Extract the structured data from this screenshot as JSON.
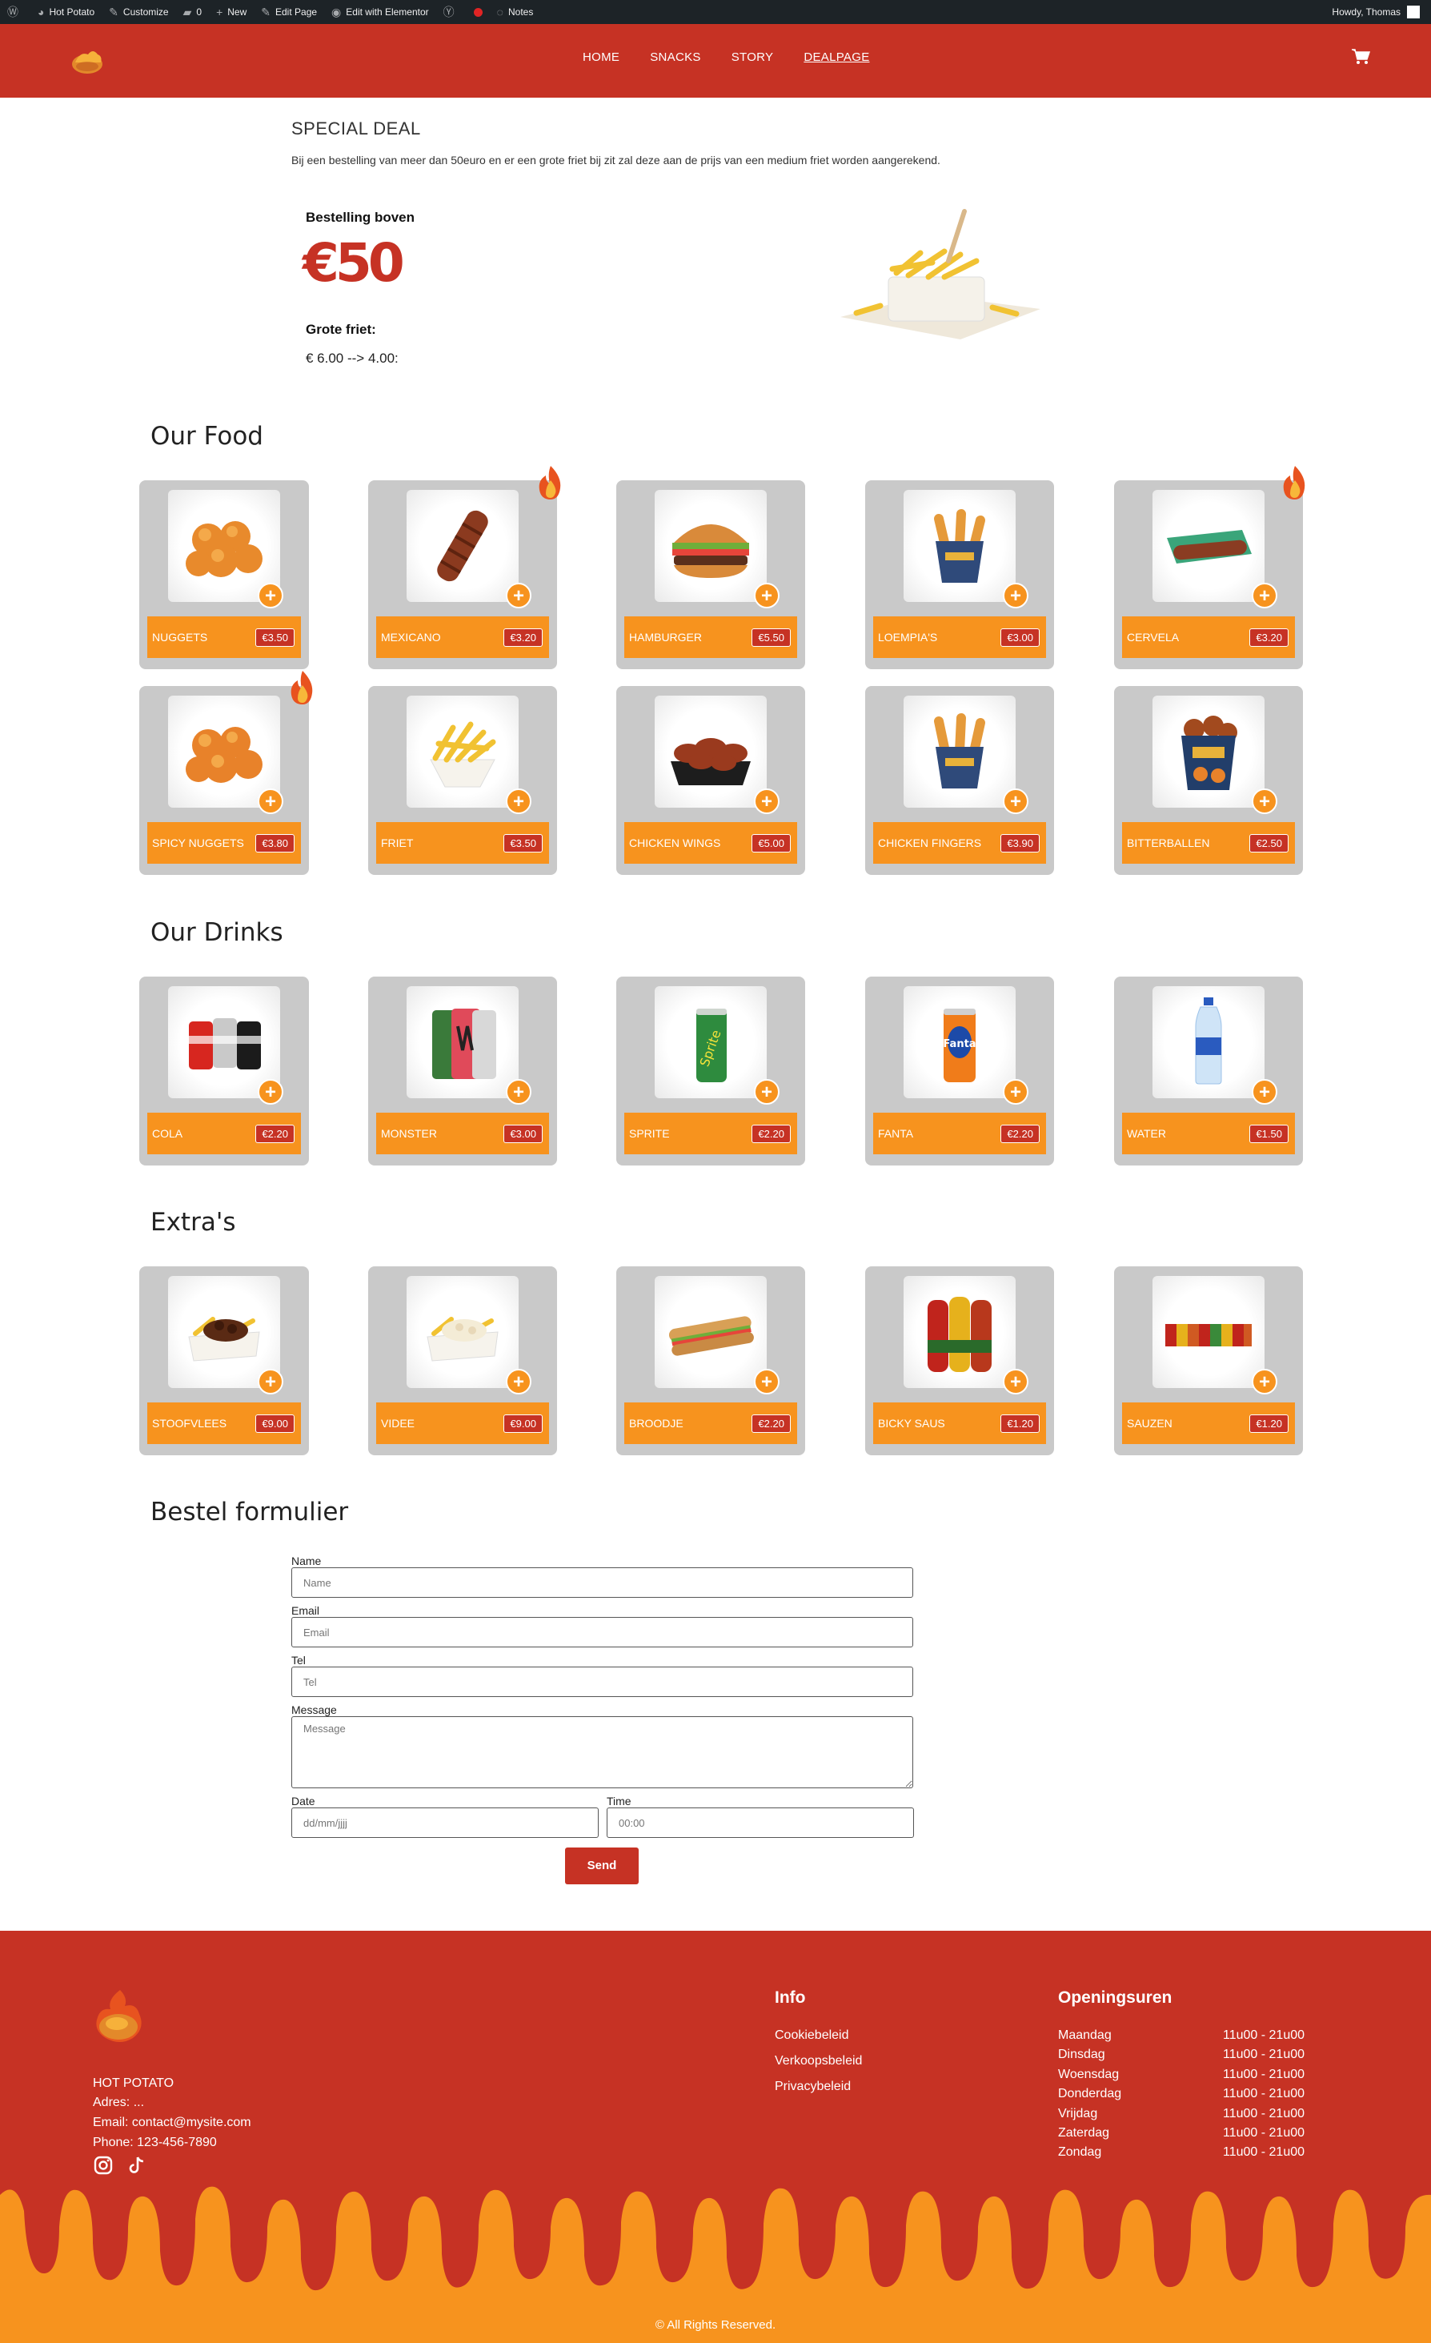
{
  "wp_admin_bar": {
    "site": "Hot Potato",
    "customize": "Customize",
    "comments": "0",
    "new": "New",
    "edit_page": "Edit Page",
    "elementor": "Edit with Elementor",
    "notes": "Notes",
    "greeting": "Howdy, Thomas"
  },
  "nav": {
    "home": "HOME",
    "snacks": "SNACKS",
    "story": "STORY",
    "dealpage": "DEALPAGE"
  },
  "deal": {
    "title": "SPECIAL DEAL",
    "description": "Bij een bestelling van meer dan 50euro en er een grote friet bij zit zal deze aan de prijs van een medium friet worden aangerekend.",
    "box_label": "Bestelling boven",
    "amount": "€50",
    "item_label": "Grote friet:",
    "price_change": "€ 6.00 --> 4.00:"
  },
  "food": {
    "title": "Our Food",
    "items": [
      {
        "name": "NUGGETS",
        "price": "€3.50"
      },
      {
        "name": "MEXICANO",
        "price": "€3.20"
      },
      {
        "name": "HAMBURGER",
        "price": "€5.50"
      },
      {
        "name": "LOEMPIA'S",
        "price": "€3.00"
      },
      {
        "name": "CERVELA",
        "price": "€3.20"
      },
      {
        "name": "SPICY NUGGETS",
        "price": "€3.80"
      },
      {
        "name": "FRIET",
        "price": "€3.50"
      },
      {
        "name": "CHICKEN WINGS",
        "price": "€5.00"
      },
      {
        "name": "CHICKEN FINGERS",
        "price": "€3.90"
      },
      {
        "name": "BITTERBALLEN",
        "price": "€2.50"
      }
    ]
  },
  "drinks": {
    "title": "Our Drinks",
    "items": [
      {
        "name": "COLA",
        "price": "€2.20"
      },
      {
        "name": "MONSTER",
        "price": "€3.00"
      },
      {
        "name": "SPRITE",
        "price": "€2.20"
      },
      {
        "name": "FANTA",
        "price": "€2.20"
      },
      {
        "name": "WATER",
        "price": "€1.50"
      }
    ]
  },
  "extras": {
    "title": "Extra's",
    "items": [
      {
        "name": "STOOFVLEES",
        "price": "€9.00"
      },
      {
        "name": "VIDEE",
        "price": "€9.00"
      },
      {
        "name": "BROODJE",
        "price": "€2.20"
      },
      {
        "name": "BICKY SAUS",
        "price": "€1.20"
      },
      {
        "name": "SAUZEN",
        "price": "€1.20"
      }
    ]
  },
  "order_form": {
    "title": "Bestel formulier",
    "name_label": "Name",
    "name_placeholder": "Name",
    "email_label": "Email",
    "email_placeholder": "Email",
    "tel_label": "Tel",
    "tel_placeholder": "Tel",
    "message_label": "Message",
    "message_placeholder": "Message",
    "date_label": "Date",
    "date_placeholder": "dd/mm/jjjj",
    "time_label": "Time",
    "time_placeholder": "00:00",
    "send": "Send"
  },
  "footer": {
    "brand": "HOT POTATO",
    "address": "Adres: ...",
    "email": "Email: contact@mysite.com",
    "phone": "Phone: 123-456-7890",
    "info_title": "Info",
    "links": [
      "Cookiebeleid",
      "Verkoopsbeleid",
      "Privacybeleid"
    ],
    "hours_title": "Openingsuren",
    "hours": [
      {
        "day": "Maandag",
        "time": "11u00 - 21u00"
      },
      {
        "day": "Dinsdag",
        "time": "11u00 - 21u00"
      },
      {
        "day": "Woensdag",
        "time": "11u00 - 21u00"
      },
      {
        "day": "Donderdag",
        "time": "11u00 - 21u00"
      },
      {
        "day": "Vrijdag",
        "time": "11u00 - 21u00"
      },
      {
        "day": "Zaterdag",
        "time": "11u00 - 21u00"
      },
      {
        "day": "Zondag",
        "time": "11u00 - 21u00"
      }
    ],
    "copyright": "© All Rights Reserved."
  }
}
